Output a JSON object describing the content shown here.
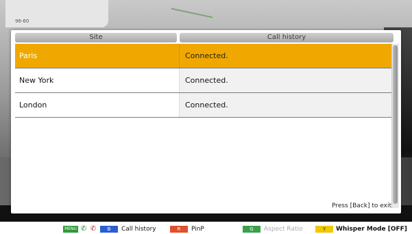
{
  "table": {
    "headers": {
      "site": "Site",
      "history": "Call history"
    },
    "rows": [
      {
        "site": "Paris",
        "status": "Connected.",
        "selected": true
      },
      {
        "site": "New York",
        "status": "Connected.",
        "selected": false
      },
      {
        "site": "London",
        "status": "Connected.",
        "selected": false
      }
    ]
  },
  "hint": "Press [Back] to exit",
  "background": {
    "text": "96-60"
  },
  "bottom_bar": {
    "menu_label": "MENU",
    "blue_key": "B",
    "blue_label": "Call history",
    "red_key": "R",
    "red_label": "PinP",
    "green_key": "G",
    "green_label": "Aspect Ratio",
    "yellow_key": "Y",
    "yellow_label": "Whisper Mode [OFF]"
  },
  "colors": {
    "selected_row": "#f0a800",
    "blue_key": "#2a5fd0",
    "red_key": "#e0502a",
    "green_key": "#3aa04a",
    "yellow_key": "#f0c800"
  },
  "icons": [
    "call-answer-icon",
    "call-hangup-icon"
  ]
}
